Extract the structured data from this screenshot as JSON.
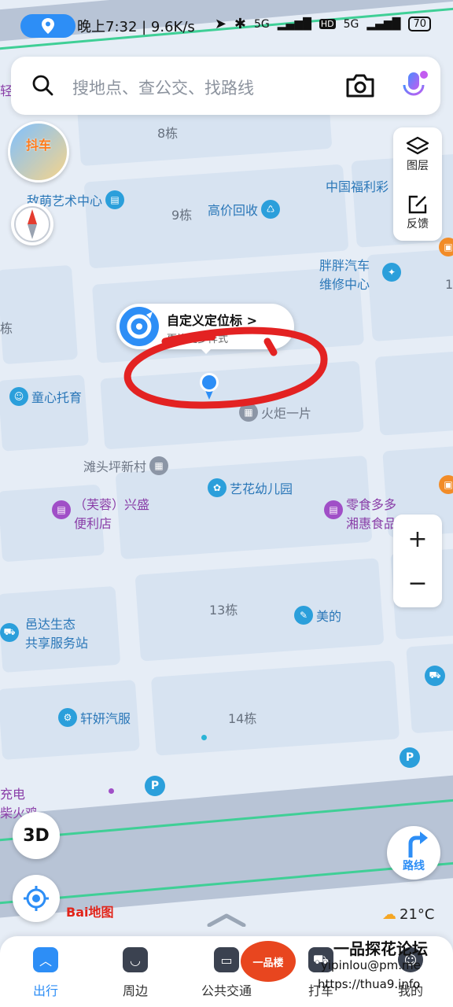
{
  "status_bar": {
    "time": "晚上7:32 | 9.6K/s",
    "network_1": "5G",
    "hd": "HD",
    "network_2": "5G",
    "battery": "70"
  },
  "search": {
    "placeholder": "搜地点、查公交、找路线"
  },
  "promo_label": "抖车",
  "right_panel": {
    "layers_label": "图层",
    "feedback_label": "反馈"
  },
  "zoom": {
    "in": "+",
    "out": "−"
  },
  "popup": {
    "title": "自定义定位标 >",
    "subtitle": "更换更多样式"
  },
  "map": {
    "pois": [
      {
        "name": "敌萌艺术中心",
        "color": "blue"
      },
      {
        "name": "高价回收",
        "color": "blue"
      },
      {
        "name": "中国福利彩",
        "color": "blue"
      },
      {
        "name": "胖胖汽车",
        "color": "blue"
      },
      {
        "name": "维修中心",
        "color": "blue"
      },
      {
        "name": "童心托育",
        "color": "blue"
      },
      {
        "name": "火炬一片",
        "color": "gray"
      },
      {
        "name": "滩头坪新村",
        "color": "gray"
      },
      {
        "name": "艺花幼儿园",
        "color": "blue"
      },
      {
        "name": "（芙蓉）兴盛",
        "color": "purple"
      },
      {
        "name": "便利店",
        "color": "purple"
      },
      {
        "name": "零食多多",
        "color": "purple"
      },
      {
        "name": "湘惠食品店",
        "color": "purple"
      },
      {
        "name": "美的",
        "color": "blue"
      },
      {
        "name": "邑达生态",
        "color": "blue"
      },
      {
        "name": "共享服务站",
        "color": "blue"
      },
      {
        "name": "轩妍汽服",
        "color": "blue"
      },
      {
        "name": "充电",
        "color": "purple"
      },
      {
        "name": "柴火鸡",
        "color": "purple"
      },
      {
        "name": "轻",
        "color": "purple"
      }
    ],
    "buildings": [
      "8栋",
      "9栋",
      "13栋",
      "14栋",
      "1",
      "栋"
    ]
  },
  "controls": {
    "three_d": "3D",
    "route": "路线",
    "baidu": "Bai地图",
    "weather": "21°C"
  },
  "bottom_nav": [
    {
      "label": "出行",
      "active": true
    },
    {
      "label": "周边",
      "active": false
    },
    {
      "label": "公共交通",
      "active": false
    },
    {
      "label": "打车",
      "active": false
    },
    {
      "label": "我的",
      "active": false
    }
  ],
  "watermark": {
    "logo": "一品楼",
    "title": "一品探花论坛",
    "email": "yipinlou@pm.me",
    "url": "https://thua9.info"
  },
  "colors": {
    "accent": "#2d8ef6",
    "poi_blue": "#2a77b8",
    "poi_purple": "#8a3ea8",
    "annotation_red": "#e32222",
    "road_green": "#3fcf96"
  }
}
